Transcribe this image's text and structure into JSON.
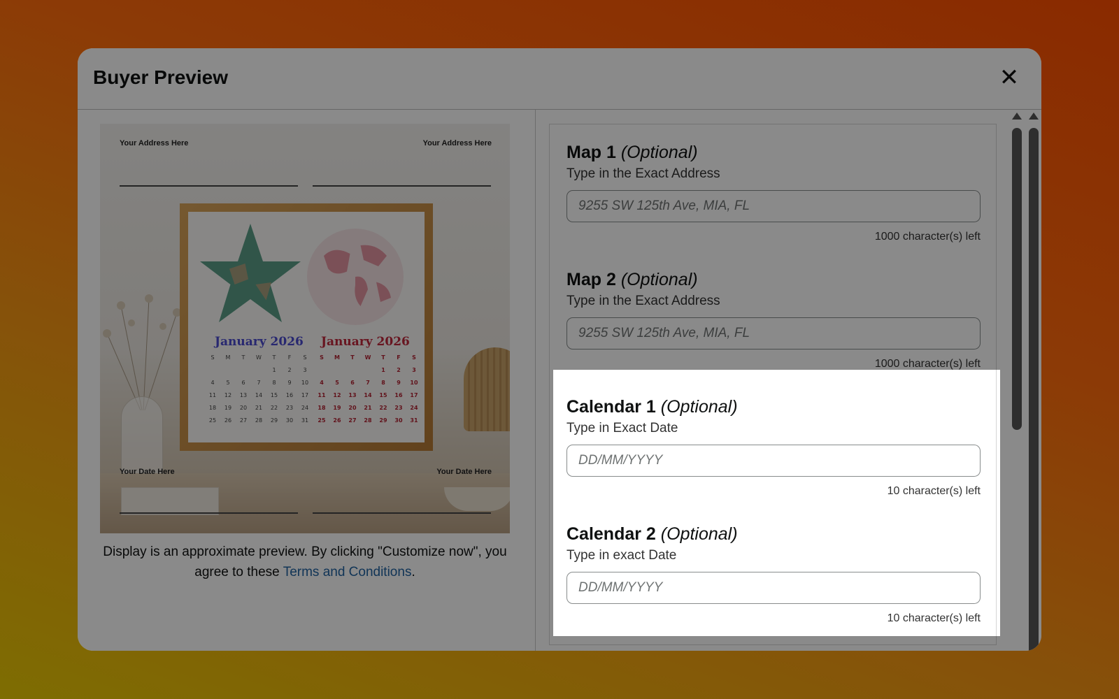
{
  "modal": {
    "title": "Buyer Preview",
    "close_icon": "close-icon"
  },
  "preview": {
    "address_left": "Your Address Here",
    "address_right": "Your Address Here",
    "date_left": "Your Date Here",
    "date_right": "Your Date Here",
    "calendar_left_title": "January 2026",
    "calendar_right_title": "January 2026",
    "calendar_left_days": [
      "S",
      "M",
      "T",
      "W",
      "T",
      "F",
      "S",
      "",
      "",
      "",
      "",
      "1",
      "2",
      "3",
      "4",
      "5",
      "6",
      "7",
      "8",
      "9",
      "10",
      "11",
      "12",
      "13",
      "14",
      "15",
      "16",
      "17",
      "18",
      "19",
      "20",
      "21",
      "22",
      "23",
      "24",
      "25",
      "26",
      "27",
      "28",
      "29",
      "30",
      "31"
    ],
    "calendar_right_days": [
      "S",
      "M",
      "T",
      "W",
      "T",
      "F",
      "S",
      "",
      "",
      "",
      "",
      "1",
      "2",
      "3",
      "4",
      "5",
      "6",
      "7",
      "8",
      "9",
      "10",
      "11",
      "12",
      "13",
      "14",
      "15",
      "16",
      "17",
      "18",
      "19",
      "20",
      "21",
      "22",
      "23",
      "24",
      "25",
      "26",
      "27",
      "28",
      "29",
      "30",
      "31"
    ],
    "caption_text": "Display is an approximate preview. By clicking \"Customize now\", you agree to these ",
    "caption_link": "Terms and Conditions",
    "caption_end": "."
  },
  "form": {
    "fields": [
      {
        "title": "Map 1",
        "optional": "(Optional)",
        "subtitle": "Type in the Exact Address",
        "placeholder": "9255 SW 125th Ave, MIA, FL",
        "count": "1000 character(s) left"
      },
      {
        "title": "Map 2",
        "optional": "(Optional)",
        "subtitle": "Type in the Exact Address",
        "placeholder": "9255 SW 125th Ave, MIA, FL",
        "count": "1000 character(s) left"
      },
      {
        "title": "Calendar 1",
        "optional": "(Optional)",
        "subtitle": "Type in Exact Date",
        "placeholder": "DD/MM/YYYY",
        "count": "10 character(s) left"
      },
      {
        "title": "Calendar 2",
        "optional": "(Optional)",
        "subtitle": "Type in exact Date",
        "placeholder": "DD/MM/YYYY",
        "count": "10 character(s) left"
      }
    ]
  },
  "colors": {
    "link": "#2162a1",
    "calendar_left": "#4a4ad0",
    "calendar_right": "#c0283c",
    "star": "#5c9e88"
  }
}
